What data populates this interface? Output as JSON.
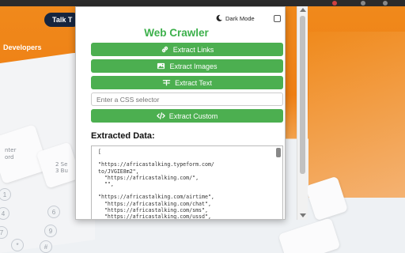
{
  "background": {
    "talk_button": "Talk T",
    "nav_developers": "Developers",
    "card_snippets": [
      "nter",
      "ord",
      "2  Se",
      "3  Bu"
    ],
    "keypad": [
      "1",
      "4",
      "7",
      "*",
      "6",
      "9",
      "#"
    ]
  },
  "popup": {
    "dark_mode_label": "Dark Mode",
    "dark_mode_checked": false,
    "title": "Web Crawler",
    "buttons": {
      "extract_links": "Extract Links",
      "extract_images": "Extract Images",
      "extract_text": "Extract Text",
      "extract_custom": "Extract Custom"
    },
    "css_selector_placeholder": "Enter a CSS selector",
    "extracted_heading": "Extracted Data:",
    "extracted_data": "[\n\n\"https://africastalking.typeform.com/\nto/JVGIE8m2\",\n  \"https://africastalking.com/\",\n  \"\",\n\n\"https://africastalking.com/airtime\",\n  \"https://africastalking.com/chat\",\n  \"https://africastalking.com/sms\",\n  \"https://africastalking.com/ussd\",\n  \"https://africastalking.com/voice\",\n\n\"https://africastalking.com/mobiledat\na\","
  },
  "colors": {
    "accent_green": "#4caf50",
    "title_green": "#3cb04b",
    "site_orange": "#f08a1c"
  }
}
